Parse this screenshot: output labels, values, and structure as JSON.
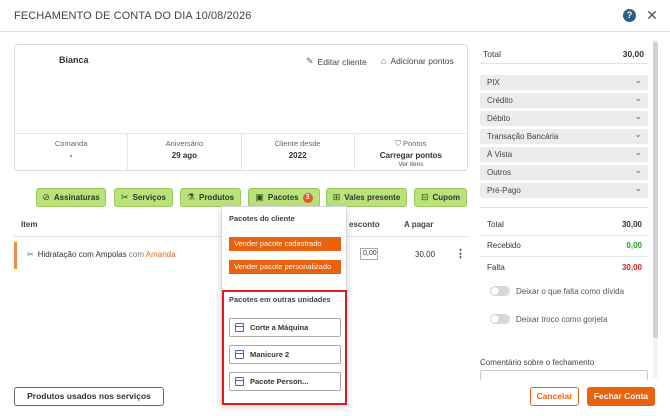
{
  "header": {
    "title": "FECHAMENTO DE CONTA DO DIA 10/08/2026",
    "help": "?",
    "close": "✕"
  },
  "client": {
    "name": "Bianca",
    "edit_label": "Editar cliente",
    "add_points_label": "Adicionar pontos",
    "stats": [
      {
        "label": "Comanda",
        "value": "-"
      },
      {
        "label": "Aniversário",
        "value": "29 ago"
      },
      {
        "label": "Cliente desde",
        "value": "2022"
      },
      {
        "label": "Pontos",
        "value": "Carregar pontos",
        "sub": "Ver itens"
      }
    ]
  },
  "categories": [
    {
      "label": "Assinaturas",
      "icon": "check-circle-icon"
    },
    {
      "label": "Serviços",
      "icon": "scissors-icon"
    },
    {
      "label": "Produtos",
      "icon": "product-icon"
    },
    {
      "label": "Pacotes",
      "icon": "package-icon",
      "badge": "3"
    },
    {
      "label": "Vales presente",
      "icon": "gift-card-icon"
    },
    {
      "label": "Cupom",
      "icon": "coupon-icon"
    }
  ],
  "table": {
    "headers": {
      "item": "Item",
      "desconto": "esconto",
      "pagar": "A pagar"
    },
    "rows": [
      {
        "name": "Hidratação com Ampolas",
        "com": "com",
        "professional": "Amanda",
        "discount": "0,00",
        "price": "30,00"
      }
    ]
  },
  "popup": {
    "client_packages_title": "Pacotes do cliente",
    "sell_registered": "Vender pacote cadastrado",
    "sell_custom": "Vender pacote personalizado",
    "other_units_title": "Pacotes em outras unidades",
    "packages": [
      "Corte a Máquina",
      "Manicure 2",
      "Pacote Person..."
    ]
  },
  "right_panel": {
    "total_label": "Total",
    "total_value": "30,00",
    "payments": [
      "PIX",
      "Crédito",
      "Débito",
      "Transação Bancária",
      "À Vista",
      "Outros",
      "Pré-Pago"
    ],
    "summary": {
      "total_label": "Total",
      "total_value": "30,00",
      "received_label": "Recebido",
      "received_value": "0,00",
      "missing_label": "Falta",
      "missing_value": "30,00"
    },
    "toggles": [
      "Deixar o que falta como dívida",
      "Deixar troco como gorjeta"
    ],
    "comment_label": "Comentário sobre o fechamento"
  },
  "footer": {
    "products_used": "Produtos usados nos serviços",
    "cancel": "Cancelar",
    "close_account": "Fechar Conta"
  },
  "colors": {
    "accent": "#e8620f",
    "category_green": "#b9e37a",
    "highlight_red": "#d81f1f",
    "received_green": "#2e9e2e",
    "missing_red": "#e02020"
  }
}
